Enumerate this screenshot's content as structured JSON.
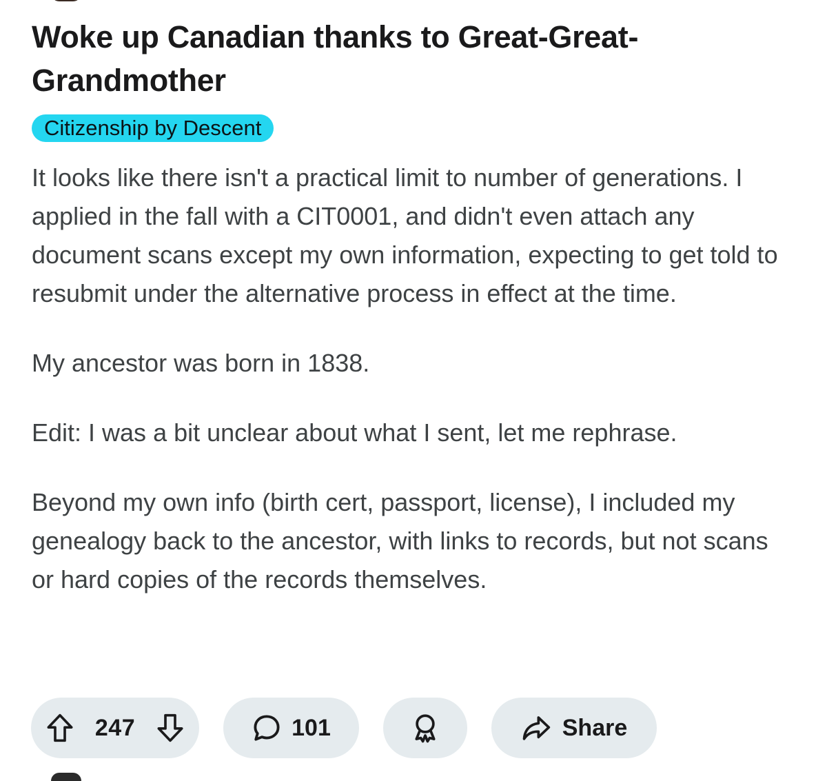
{
  "post": {
    "title": "Woke up Canadian thanks to Great-Great-Grandmother",
    "flair": "Citizenship by Descent",
    "paragraphs": [
      "It looks like there isn't a practical limit to number of generations. I applied in the fall with a CIT0001, and didn't even attach any document scans except my own information, expecting to get told to resubmit under the alternative process in effect at the time.",
      "My ancestor was born in 1838.",
      "Edit: I was a bit unclear about what I sent, let me rephrase.",
      "Beyond my own info (birth cert, passport, license), I included my genealogy back to the ancestor, with links to records, but not scans or hard copies of the records themselves."
    ]
  },
  "actions": {
    "upvote_icon": "arrow-up-icon",
    "vote_count": "247",
    "downvote_icon": "arrow-down-icon",
    "comment_icon": "speech-bubble-icon",
    "comment_count": "101",
    "award_icon": "award-ribbon-icon",
    "share_icon": "share-arrow-icon",
    "share_label": "Share"
  },
  "colors": {
    "flair_background": "#24d6f0",
    "pill_background": "#e5ebee",
    "title_text": "#1a1a1b",
    "body_text": "#3e4244"
  }
}
